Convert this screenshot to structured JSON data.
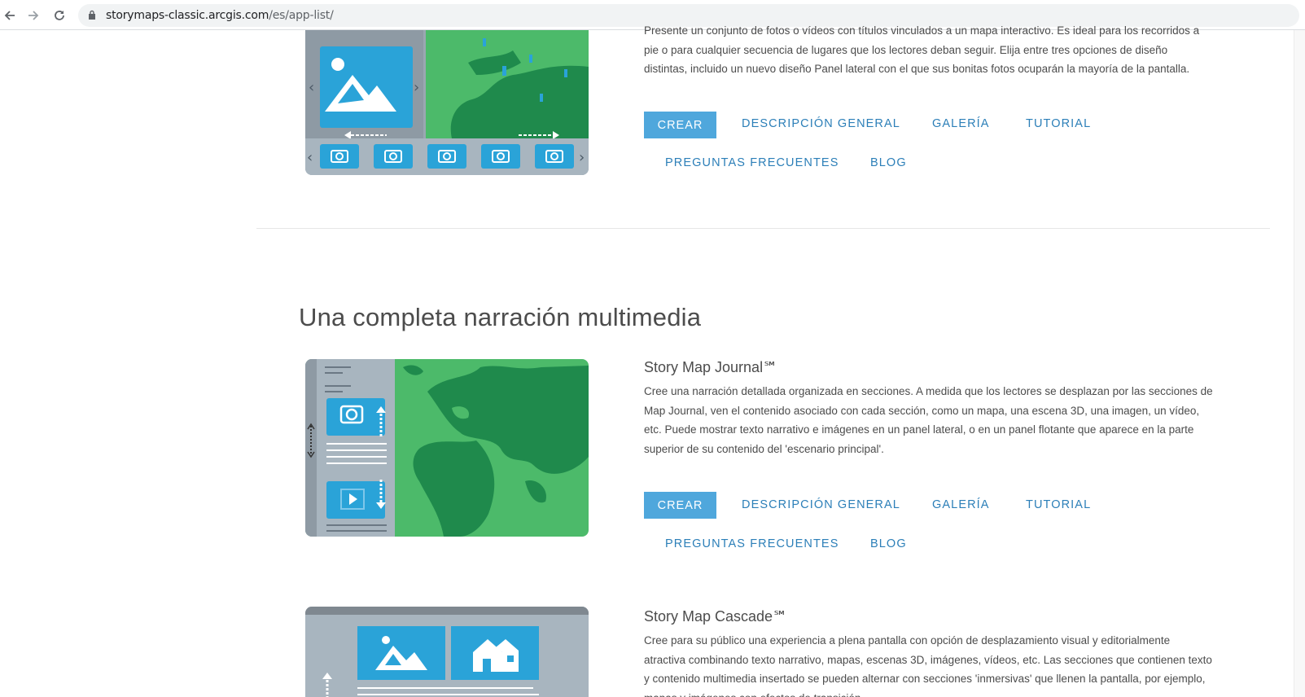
{
  "browser": {
    "url_domain": "storymaps-classic.arcgis.com",
    "url_path": "/es/app-list/"
  },
  "app1": {
    "description": "Presente un conjunto de fotos o vídeos con títulos vinculados a un mapa interactivo. Es ideal para los recorridos a pie o para cualquier secuencia de lugares que los lectores deban seguir. Elija entre tres opciones de diseño distintas, incluido un nuevo diseño Panel lateral con el que sus bonitas fotos ocuparán la mayoría de la pantalla.",
    "buttons": {
      "create": "CREAR",
      "overview": "DESCRIPCIÓN GENERAL",
      "gallery": "GALERÍA",
      "tutorial": "TUTORIAL",
      "faq": "PREGUNTAS FRECUENTES",
      "blog": "BLOG"
    }
  },
  "section": {
    "title": "Una completa narración multimedia"
  },
  "journal": {
    "title": "Story Map Journal℠",
    "description": "Cree una narración detallada organizada en secciones. A medida que los lectores se desplazan por las secciones de Map Journal, ven el contenido asociado con cada sección, como un mapa, una escena 3D, una imagen, un vídeo, etc. Puede mostrar texto narrativo e imágenes en un panel lateral, o en un panel flotante que aparece en la parte superior de su contenido del 'escenario principal'.",
    "buttons": {
      "create": "CREAR",
      "overview": "DESCRIPCIÓN GENERAL",
      "gallery": "GALERÍA",
      "tutorial": "TUTORIAL",
      "faq": "PREGUNTAS FRECUENTES",
      "blog": "BLOG"
    }
  },
  "cascade": {
    "title": "Story Map Cascade℠",
    "description": "Cree para su público una experiencia a plena pantalla con opción de desplazamiento visual y editorialmente atractiva combinando texto narrativo, mapas, escenas 3D, imágenes, vídeos, etc. Las secciones que contienen texto y contenido multimedia insertado se pueden alternar con secciones 'inmersivas' que llenen la pantalla, por ejemplo, mapas y imágenes con efectos de transición."
  },
  "colors": {
    "accent_button": "#4fa7dc",
    "link": "#2c7fb8",
    "map_green": "#4cba6a",
    "land_green": "#1f8a4c"
  }
}
